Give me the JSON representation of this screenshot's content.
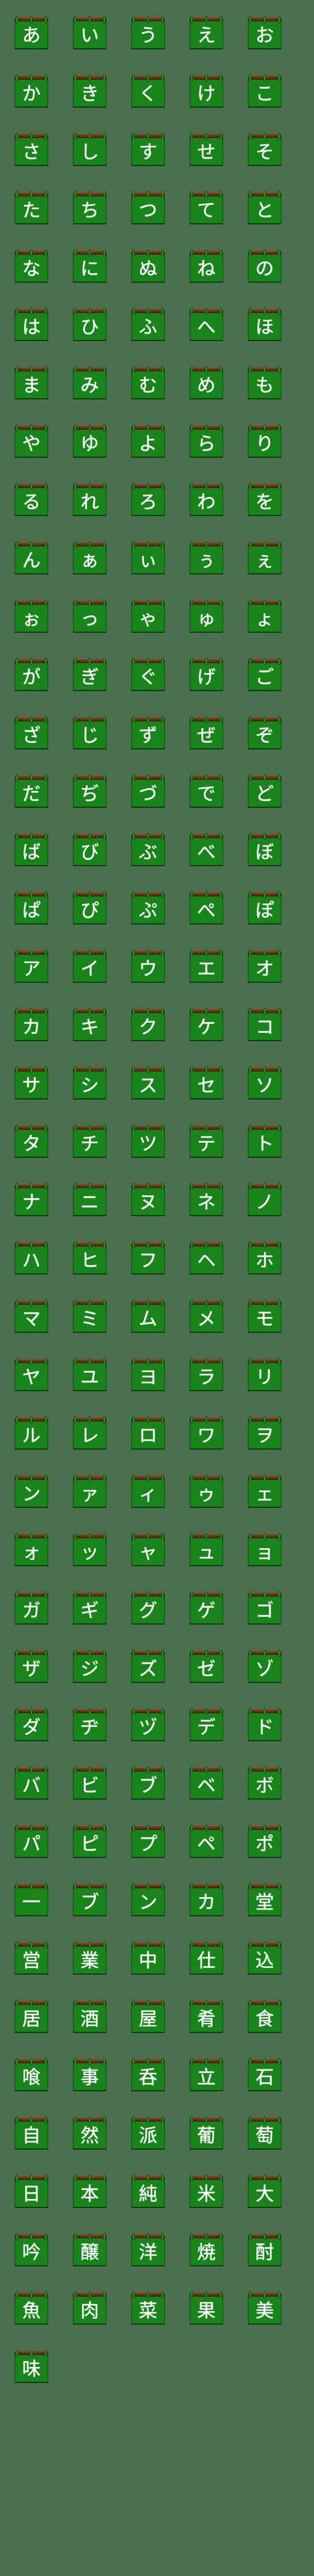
{
  "sheet": {
    "title": "Japanese Chalkboard Hanging Sign Emoji Sheet",
    "columns": 5,
    "total_tiles": 201,
    "colors": {
      "background": "#4a7050",
      "board_green": "#17851a",
      "board_edge": "#0d4a10",
      "rail_brown": "#6b3318",
      "rail_highlight": "#8a4a26",
      "clip_green": "#1f9a22",
      "chalk_white": "#ffffff"
    },
    "tile_icon_name": "hanging-chalkboard-sign"
  },
  "rows": [
    {
      "index": 0,
      "group": "hiragana-seion",
      "cells": [
        "あ",
        "い",
        "う",
        "え",
        "お"
      ]
    },
    {
      "index": 1,
      "group": "hiragana-seion",
      "cells": [
        "か",
        "き",
        "く",
        "け",
        "こ"
      ]
    },
    {
      "index": 2,
      "group": "hiragana-seion",
      "cells": [
        "さ",
        "し",
        "す",
        "せ",
        "そ"
      ]
    },
    {
      "index": 3,
      "group": "hiragana-seion",
      "cells": [
        "た",
        "ち",
        "つ",
        "て",
        "と"
      ]
    },
    {
      "index": 4,
      "group": "hiragana-seion",
      "cells": [
        "な",
        "に",
        "ぬ",
        "ね",
        "の"
      ]
    },
    {
      "index": 5,
      "group": "hiragana-seion",
      "cells": [
        "は",
        "ひ",
        "ふ",
        "へ",
        "ほ"
      ]
    },
    {
      "index": 6,
      "group": "hiragana-seion",
      "cells": [
        "ま",
        "み",
        "む",
        "め",
        "も"
      ]
    },
    {
      "index": 7,
      "group": "hiragana-seion",
      "cells": [
        "や",
        "ゆ",
        "よ",
        "ら",
        "り"
      ]
    },
    {
      "index": 8,
      "group": "hiragana-seion",
      "cells": [
        "る",
        "れ",
        "ろ",
        "わ",
        "を"
      ]
    },
    {
      "index": 9,
      "group": "hiragana-small",
      "cells": [
        "ん",
        "ぁ",
        "ぃ",
        "ぅ",
        "ぇ"
      ]
    },
    {
      "index": 10,
      "group": "hiragana-small",
      "cells": [
        "ぉ",
        "っ",
        "ゃ",
        "ゅ",
        "ょ"
      ]
    },
    {
      "index": 11,
      "group": "hiragana-dakuon",
      "cells": [
        "が",
        "ぎ",
        "ぐ",
        "げ",
        "ご"
      ]
    },
    {
      "index": 12,
      "group": "hiragana-dakuon",
      "cells": [
        "ざ",
        "じ",
        "ず",
        "ぜ",
        "ぞ"
      ]
    },
    {
      "index": 13,
      "group": "hiragana-dakuon",
      "cells": [
        "だ",
        "ぢ",
        "づ",
        "で",
        "ど"
      ]
    },
    {
      "index": 14,
      "group": "hiragana-dakuon",
      "cells": [
        "ば",
        "び",
        "ぶ",
        "べ",
        "ぼ"
      ]
    },
    {
      "index": 15,
      "group": "hiragana-handakuon",
      "cells": [
        "ぱ",
        "ぴ",
        "ぷ",
        "ぺ",
        "ぽ"
      ]
    },
    {
      "index": 16,
      "group": "katakana-seion",
      "cells": [
        "ア",
        "イ",
        "ウ",
        "エ",
        "オ"
      ]
    },
    {
      "index": 17,
      "group": "katakana-seion",
      "cells": [
        "カ",
        "キ",
        "ク",
        "ケ",
        "コ"
      ]
    },
    {
      "index": 18,
      "group": "katakana-seion",
      "cells": [
        "サ",
        "シ",
        "ス",
        "セ",
        "ソ"
      ]
    },
    {
      "index": 19,
      "group": "katakana-seion",
      "cells": [
        "タ",
        "チ",
        "ツ",
        "テ",
        "ト"
      ]
    },
    {
      "index": 20,
      "group": "katakana-seion",
      "cells": [
        "ナ",
        "ニ",
        "ヌ",
        "ネ",
        "ノ"
      ]
    },
    {
      "index": 21,
      "group": "katakana-seion",
      "cells": [
        "ハ",
        "ヒ",
        "フ",
        "ヘ",
        "ホ"
      ]
    },
    {
      "index": 22,
      "group": "katakana-seion",
      "cells": [
        "マ",
        "ミ",
        "ム",
        "メ",
        "モ"
      ]
    },
    {
      "index": 23,
      "group": "katakana-seion",
      "cells": [
        "ヤ",
        "ユ",
        "ヨ",
        "ラ",
        "リ"
      ]
    },
    {
      "index": 24,
      "group": "katakana-seion",
      "cells": [
        "ル",
        "レ",
        "ロ",
        "ワ",
        "ヲ"
      ]
    },
    {
      "index": 25,
      "group": "katakana-small",
      "cells": [
        "ン",
        "ァ",
        "ィ",
        "ゥ",
        "ェ"
      ]
    },
    {
      "index": 26,
      "group": "katakana-small",
      "cells": [
        "ォ",
        "ッ",
        "ャ",
        "ュ",
        "ョ"
      ]
    },
    {
      "index": 27,
      "group": "katakana-dakuon",
      "cells": [
        "ガ",
        "ギ",
        "グ",
        "ゲ",
        "ゴ"
      ]
    },
    {
      "index": 28,
      "group": "katakana-dakuon",
      "cells": [
        "ザ",
        "ジ",
        "ズ",
        "ゼ",
        "ゾ"
      ]
    },
    {
      "index": 29,
      "group": "katakana-dakuon",
      "cells": [
        "ダ",
        "ヂ",
        "ヅ",
        "デ",
        "ド"
      ]
    },
    {
      "index": 30,
      "group": "katakana-dakuon",
      "cells": [
        "バ",
        "ビ",
        "ブ",
        "ベ",
        "ボ"
      ]
    },
    {
      "index": 31,
      "group": "katakana-handakuon",
      "cells": [
        "パ",
        "ピ",
        "プ",
        "ペ",
        "ポ"
      ]
    },
    {
      "index": 32,
      "group": "kanji-words",
      "cells": [
        "一",
        "ブ",
        "ン",
        "カ",
        "堂"
      ]
    },
    {
      "index": 33,
      "group": "kanji-words",
      "cells": [
        "営",
        "業",
        "中",
        "仕",
        "込"
      ]
    },
    {
      "index": 34,
      "group": "kanji-words",
      "cells": [
        "居",
        "酒",
        "屋",
        "肴",
        "食"
      ]
    },
    {
      "index": 35,
      "group": "kanji-words",
      "cells": [
        "喰",
        "事",
        "呑",
        "立",
        "石"
      ]
    },
    {
      "index": 36,
      "group": "kanji-words",
      "cells": [
        "自",
        "然",
        "派",
        "葡",
        "萄"
      ]
    },
    {
      "index": 37,
      "group": "kanji-words",
      "cells": [
        "日",
        "本",
        "純",
        "米",
        "大"
      ]
    },
    {
      "index": 38,
      "group": "kanji-words",
      "cells": [
        "吟",
        "醸",
        "洋",
        "焼",
        "酎"
      ]
    },
    {
      "index": 39,
      "group": "kanji-words",
      "cells": [
        "魚",
        "肉",
        "菜",
        "果",
        "美"
      ]
    },
    {
      "index": 40,
      "group": "kanji-words",
      "cells": [
        "味",
        "",
        "",
        "",
        ""
      ]
    }
  ]
}
